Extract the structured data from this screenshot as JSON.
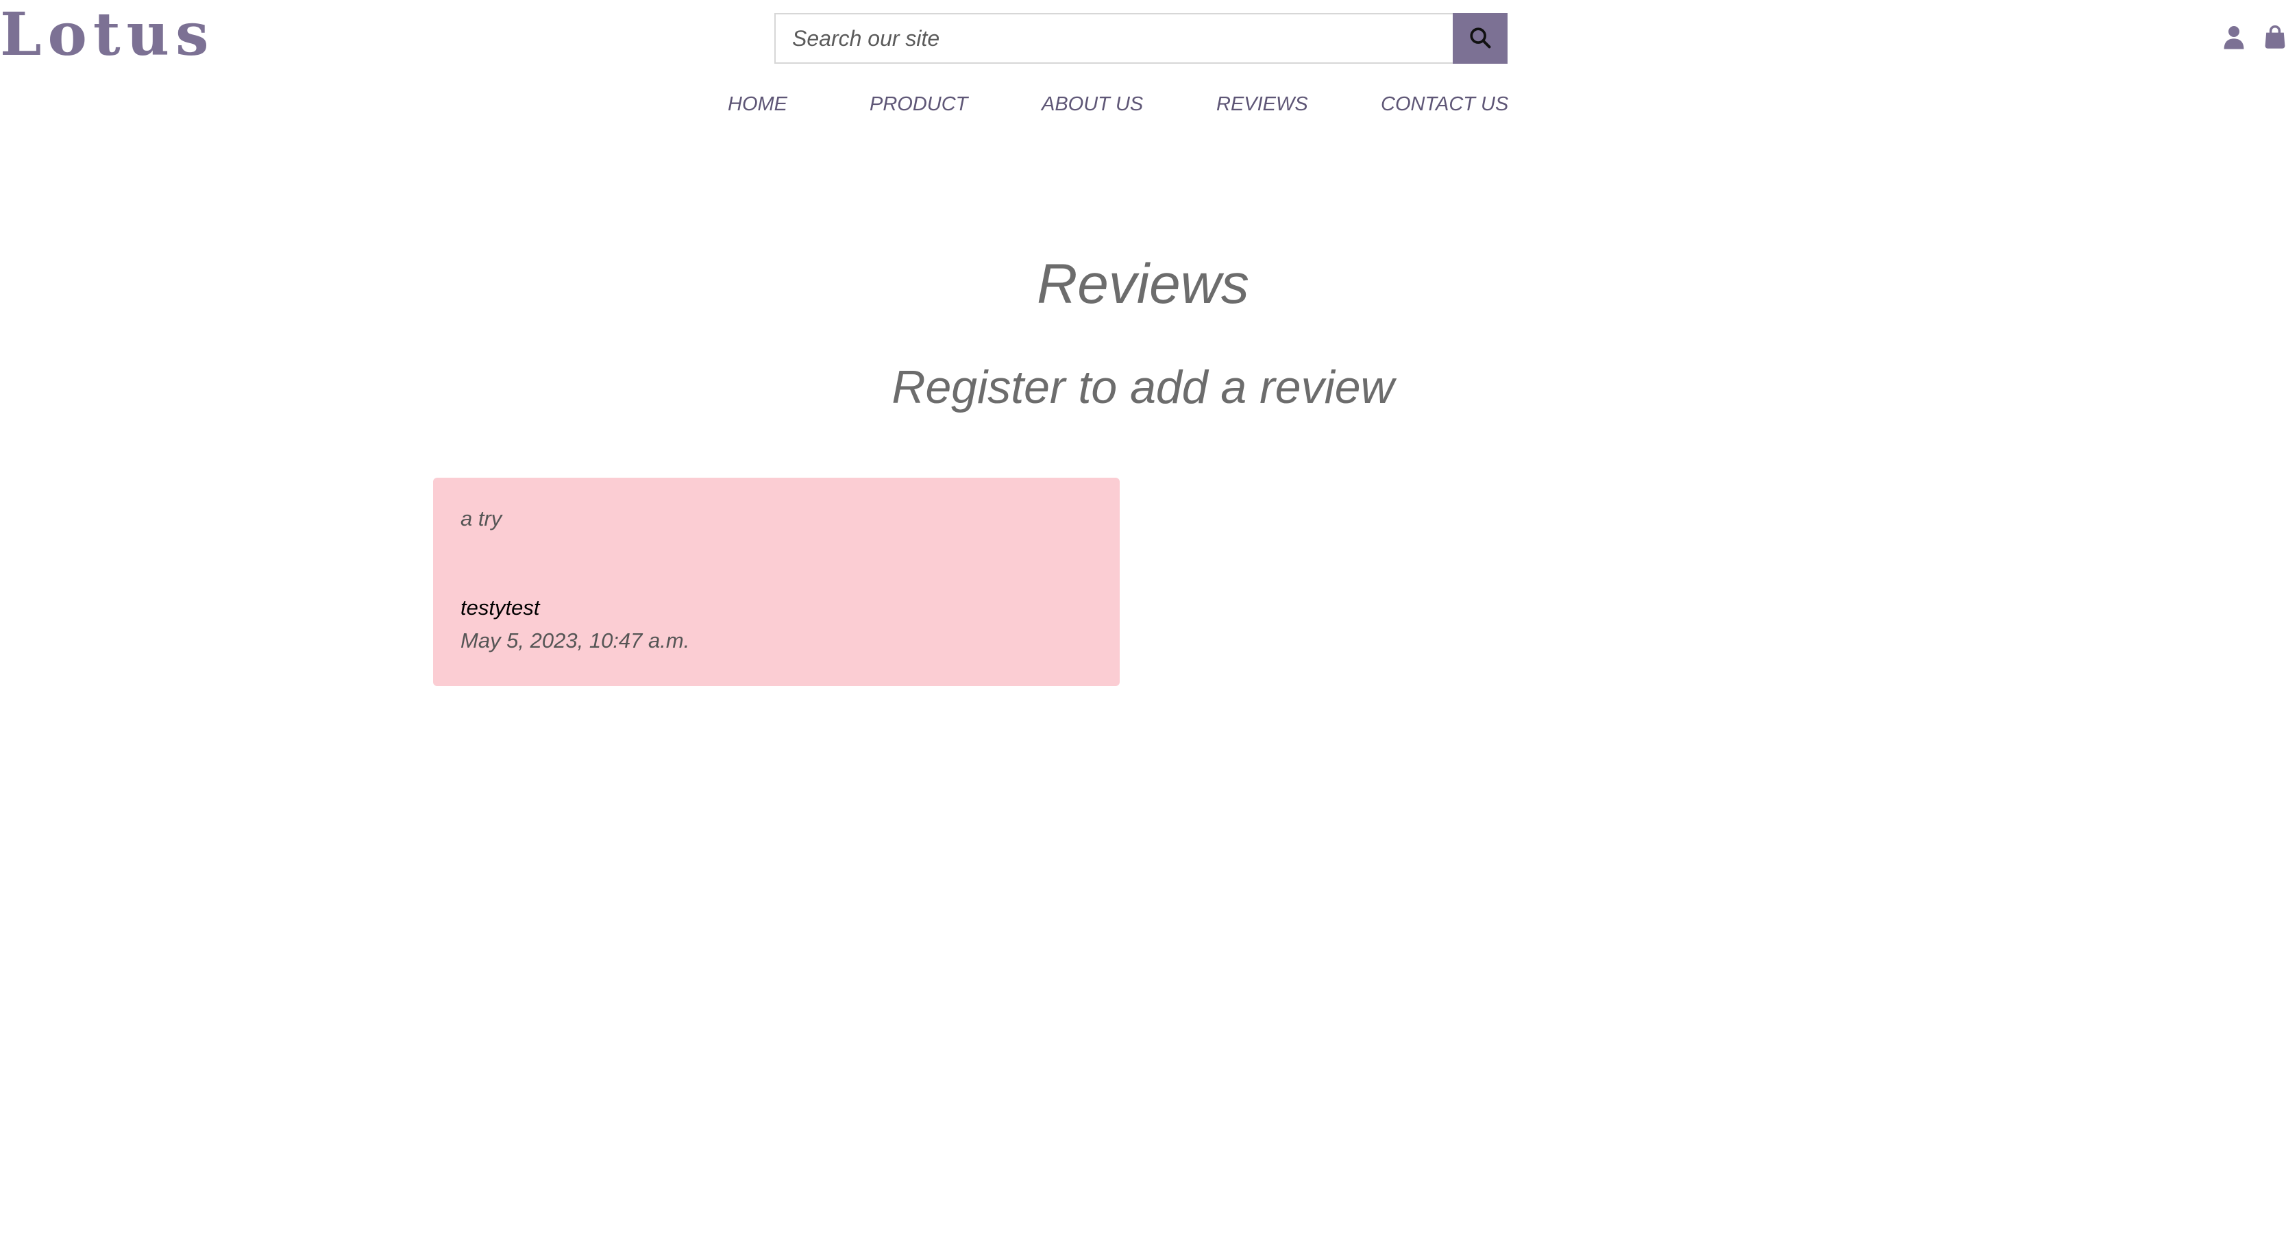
{
  "header": {
    "logo_text": "Lotus",
    "search": {
      "placeholder": "Search our site",
      "value": "",
      "button_icon": "search-icon"
    },
    "icons": [
      "user-icon",
      "shopping-bag-icon"
    ]
  },
  "nav": {
    "items": [
      {
        "label": "HOME"
      },
      {
        "label": "PRODUCT"
      },
      {
        "label": "ABOUT US"
      },
      {
        "label": "REVIEWS"
      },
      {
        "label": "CONTACT US"
      }
    ]
  },
  "main": {
    "title": "Reviews",
    "subtitle": "Register to add a review",
    "reviews": [
      {
        "text": "a try",
        "author": "testytest",
        "date": "May 5, 2023, 10:47 a.m."
      }
    ]
  },
  "colors": {
    "brand": "#7c7194",
    "nav_text": "#5e5676",
    "card_bg": "#fbcdd3",
    "heading_text": "#6c6c6c"
  }
}
